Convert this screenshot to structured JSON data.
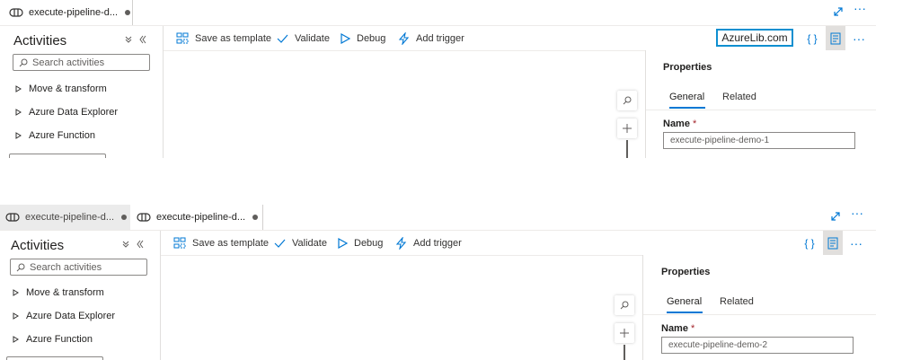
{
  "panel1": {
    "tab_label": "execute-pipeline-d...",
    "sidebar": {
      "title": "Activities",
      "search_placeholder": "Search activities",
      "categories": [
        "Move & transform",
        "Azure Data Explorer",
        "Azure Function"
      ]
    },
    "toolbar": {
      "save_template": "Save as template",
      "validate": "Validate",
      "debug": "Debug",
      "add_trigger": "Add trigger"
    },
    "watermark": "AzureLib.com",
    "properties": {
      "title": "Properties",
      "tabs": [
        "General",
        "Related"
      ],
      "name_label": "Name",
      "required_mark": "*",
      "name_value": "execute-pipeline-demo-1"
    }
  },
  "panel2": {
    "tabs": [
      "execute-pipeline-d...",
      "execute-pipeline-d..."
    ],
    "sidebar": {
      "title": "Activities",
      "search_placeholder": "Search activities",
      "categories": [
        "Move & transform",
        "Azure Data Explorer",
        "Azure Function"
      ]
    },
    "toolbar": {
      "save_template": "Save as template",
      "validate": "Validate",
      "debug": "Debug",
      "add_trigger": "Add trigger"
    },
    "properties": {
      "title": "Properties",
      "tabs": [
        "General",
        "Related"
      ],
      "name_label": "Name",
      "required_mark": "*",
      "name_value": "execute-pipeline-demo-2"
    }
  },
  "icons": {
    "tab": "pipeline-icon",
    "expand": "expand-icon",
    "more": "more-icon",
    "collapse_all": "collapse-all-icon",
    "collapse_pane": "collapse-pane-icon",
    "search": "search-icon",
    "category": "chevron-right-icon",
    "save_template": "save-template-icon",
    "validate": "check-icon",
    "debug": "play-icon",
    "trigger": "lightning-icon",
    "code": "code-icon",
    "properties": "properties-icon",
    "zoom_search": "search-icon",
    "zoom_in": "plus-icon"
  },
  "colors": {
    "accent": "#0078d4",
    "watermark_border": "#0e8fd0",
    "required": "#a4262c",
    "inactive_tab": "#ebebeb"
  }
}
